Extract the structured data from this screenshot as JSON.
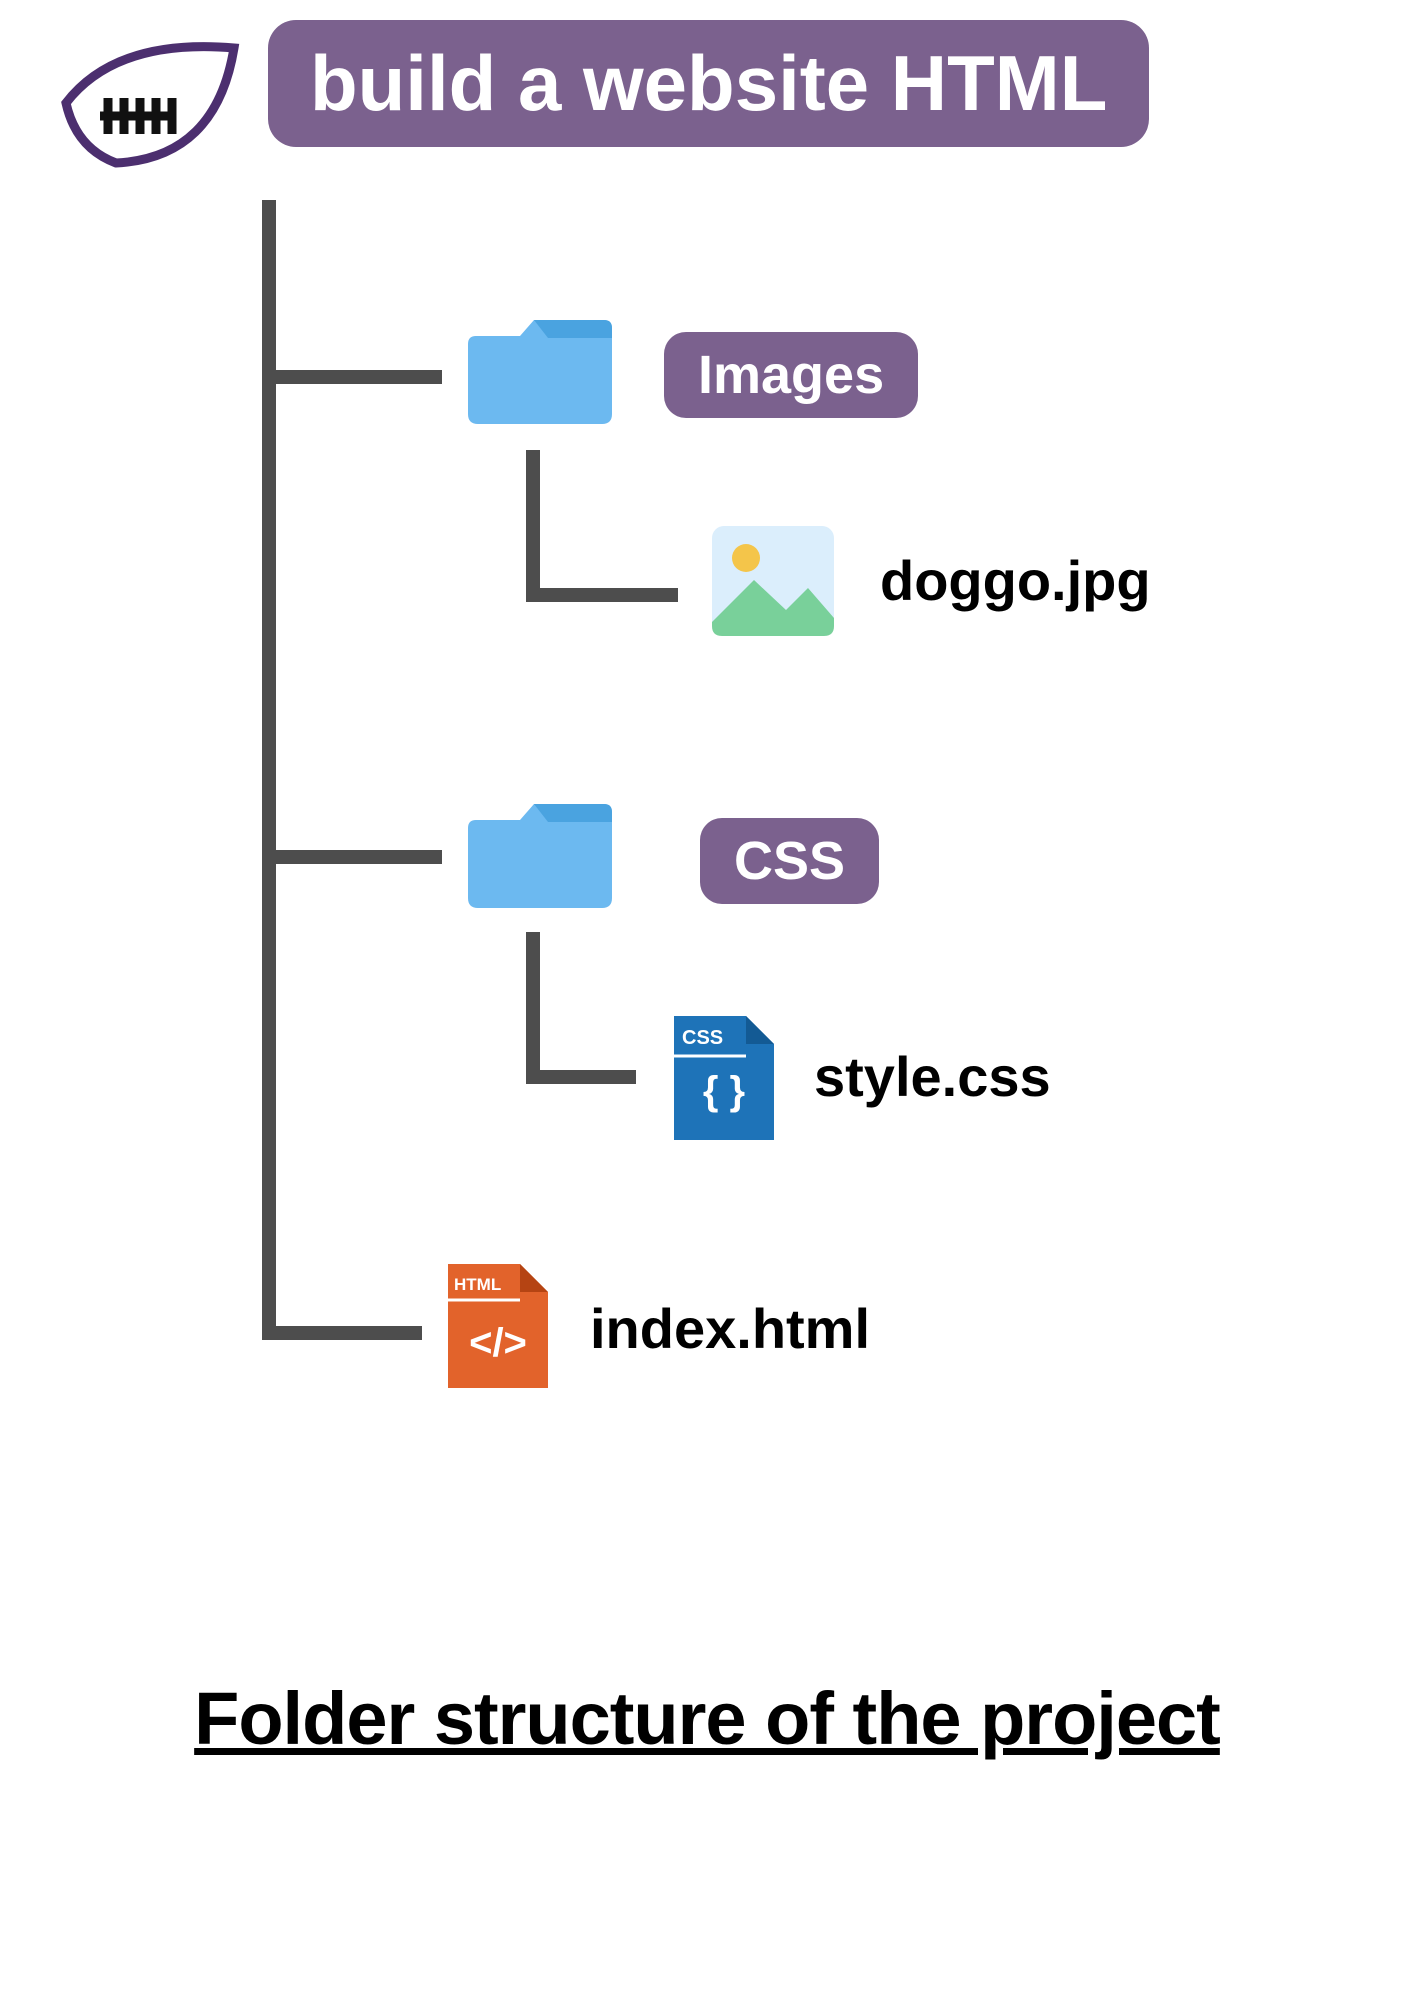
{
  "root": {
    "title": "build a website HTML"
  },
  "folders": {
    "images": {
      "label": "Images",
      "file": "doggo.jpg"
    },
    "css": {
      "label": "CSS",
      "file": "style.css"
    }
  },
  "rootFile": "index.html",
  "caption": "Folder structure of the project",
  "iconText": {
    "css": "CSS",
    "html": "HTML"
  },
  "colors": {
    "badge": "#7b618e",
    "folder": "#6cb9f0",
    "line": "#4d4d4d",
    "cssFile": "#1e73b8",
    "htmlFile": "#e2632b"
  }
}
